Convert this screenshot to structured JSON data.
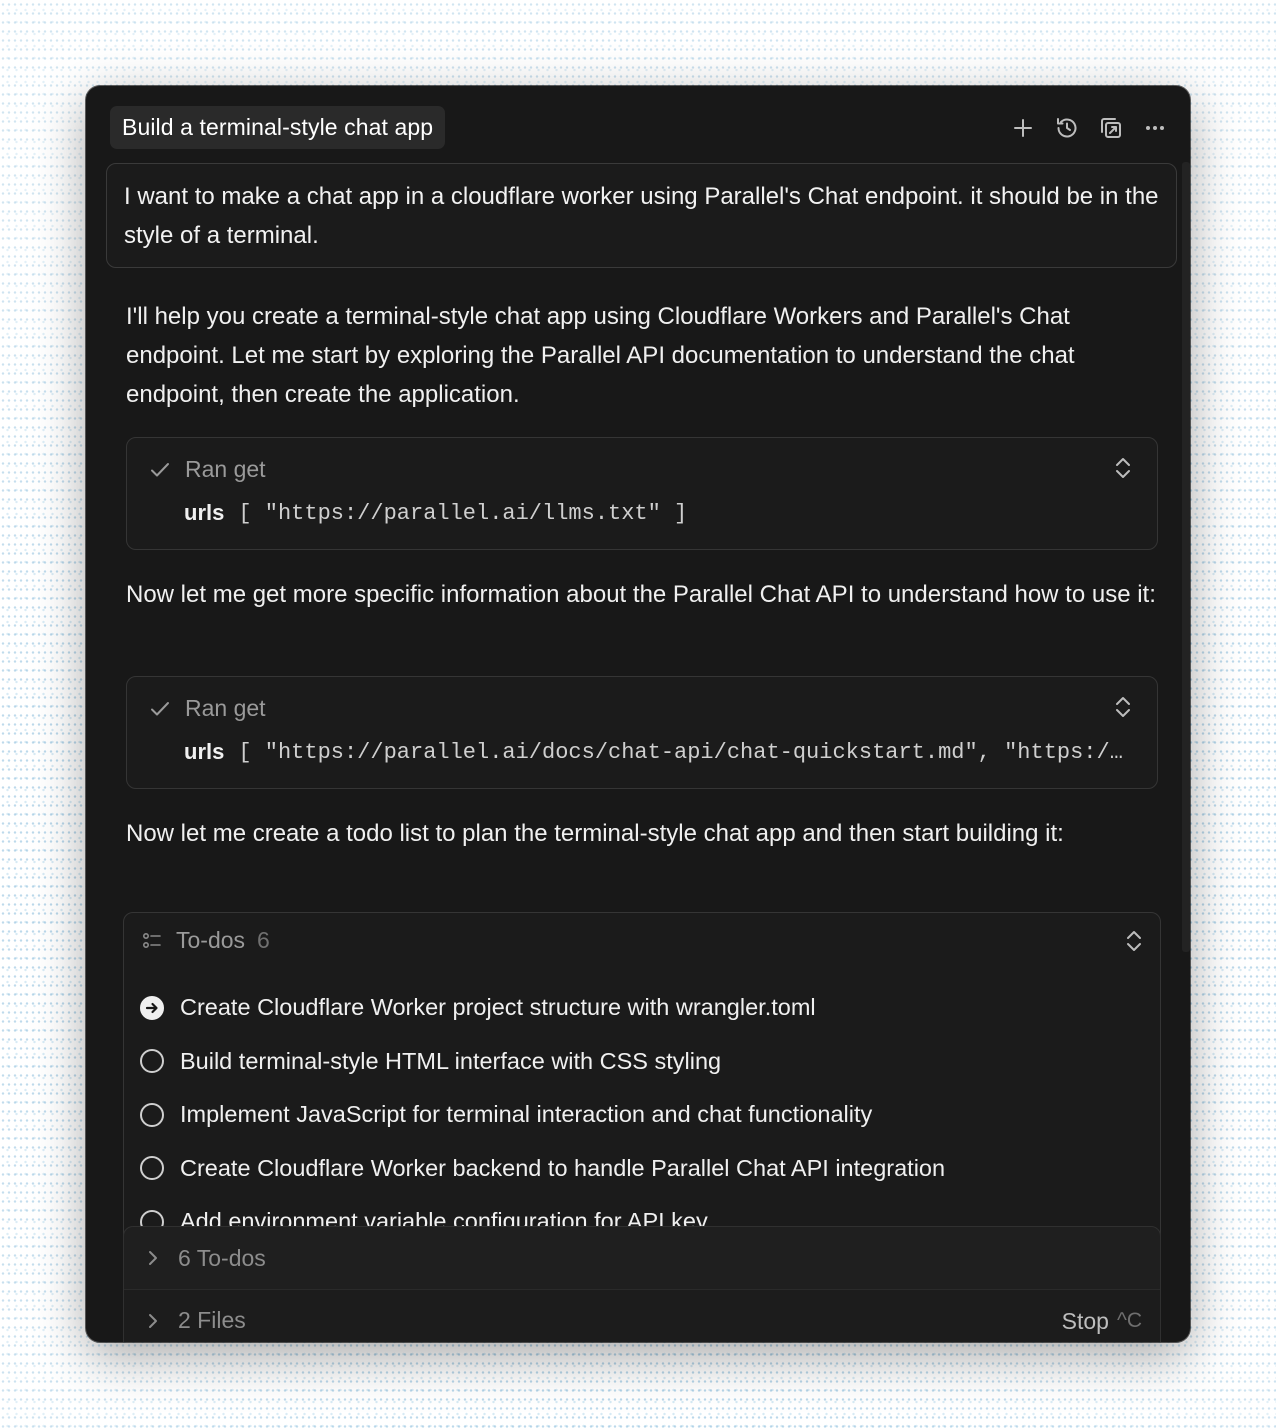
{
  "window": {
    "title": "Build a terminal-style chat app",
    "toolbar_icons": [
      "plus-icon",
      "history-icon",
      "open-external-icon",
      "more-icon"
    ]
  },
  "user_message": "I want to make a chat app in a cloudflare worker using Parallel's Chat endpoint. it should be in the style of a terminal.",
  "assistant": {
    "para1": "I'll help you create a terminal-style chat app using Cloudflare Workers and Parallel's Chat endpoint. Let me start by exploring the Parallel API documentation to understand the chat endpoint, then create the application.",
    "tool1": {
      "status": "Ran get",
      "arg_key": "urls",
      "arg_value": "[ \"https://parallel.ai/llms.txt\" ]"
    },
    "para2": "Now let me get more specific information about the Parallel Chat API to understand how to use it:",
    "tool2": {
      "status": "Ran get",
      "arg_key": "urls",
      "arg_value": "[ \"https://parallel.ai/docs/chat-api/chat-quickstart.md\", \"https://…"
    },
    "para3": "Now let me create a todo list to plan the terminal-style chat app and then start building it:"
  },
  "todos": {
    "label": "To-dos",
    "count": "6",
    "items": [
      {
        "text": "Create Cloudflare Worker project structure with wrangler.toml",
        "state": "in-progress"
      },
      {
        "text": "Build terminal-style HTML interface with CSS styling",
        "state": "pending"
      },
      {
        "text": "Implement JavaScript for terminal interaction and chat functionality",
        "state": "pending"
      },
      {
        "text": "Create Cloudflare Worker backend to handle Parallel Chat API integration",
        "state": "pending"
      },
      {
        "text": "Add environment variable configuration for API key",
        "state": "pending"
      }
    ]
  },
  "bottom_panel": {
    "todos_label": "6 To-dos",
    "files_label": "2 Files",
    "stop_label": "Stop",
    "stop_shortcut": "^C"
  }
}
